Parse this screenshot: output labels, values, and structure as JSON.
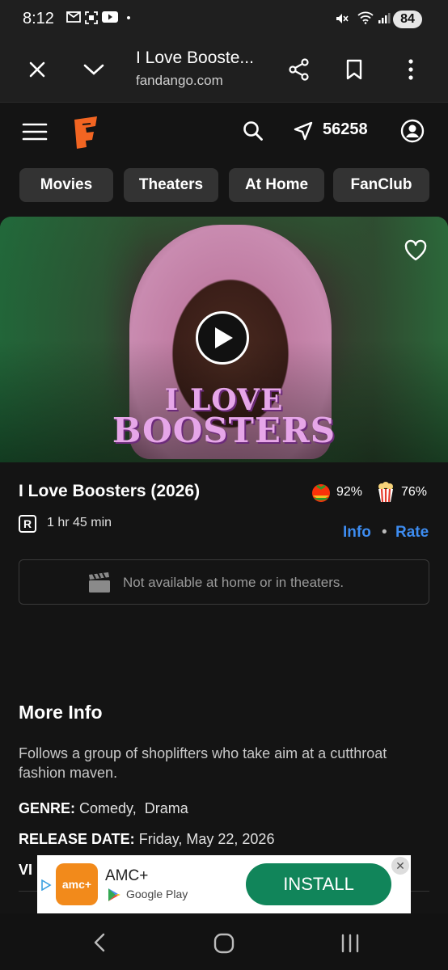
{
  "status_bar": {
    "time": "8:12",
    "battery": "84"
  },
  "browser": {
    "page_title": "I Love Booste...",
    "url": "fandango.com"
  },
  "header": {
    "zip_code": "56258"
  },
  "nav_tabs": [
    {
      "label": "Movies"
    },
    {
      "label": "Theaters"
    },
    {
      "label": "At Home"
    },
    {
      "label": "FanClub"
    }
  ],
  "hero": {
    "logo_line1": "I LOVE",
    "logo_line2": "BOOSTERS"
  },
  "movie": {
    "title": "I Love Boosters (2026)",
    "rating": "R",
    "runtime": "1 hr 45 min",
    "tomatometer": "92%",
    "audience_score": "76%",
    "info_link": "Info",
    "separator": "•",
    "rate_link": "Rate",
    "availability": "Not available at home or in theaters."
  },
  "more_info": {
    "heading": "More Info",
    "synopsis": "Follows a group of shoplifters who take aim at a cutthroat fashion maven.",
    "genre_label": "GENRE:",
    "genre_value": "Comedy,  Drama",
    "release_label": "RELEASE DATE:",
    "release_value": "Friday, May 22, 2026",
    "partial_label": "VI"
  },
  "ad": {
    "app_icon_text": "amc+",
    "app_name": "AMC+",
    "store": "Google Play",
    "install": "INSTALL",
    "close": "✕"
  },
  "colors": {
    "link": "#3d8cf0",
    "install": "#11855a",
    "brand": "#f26522"
  }
}
